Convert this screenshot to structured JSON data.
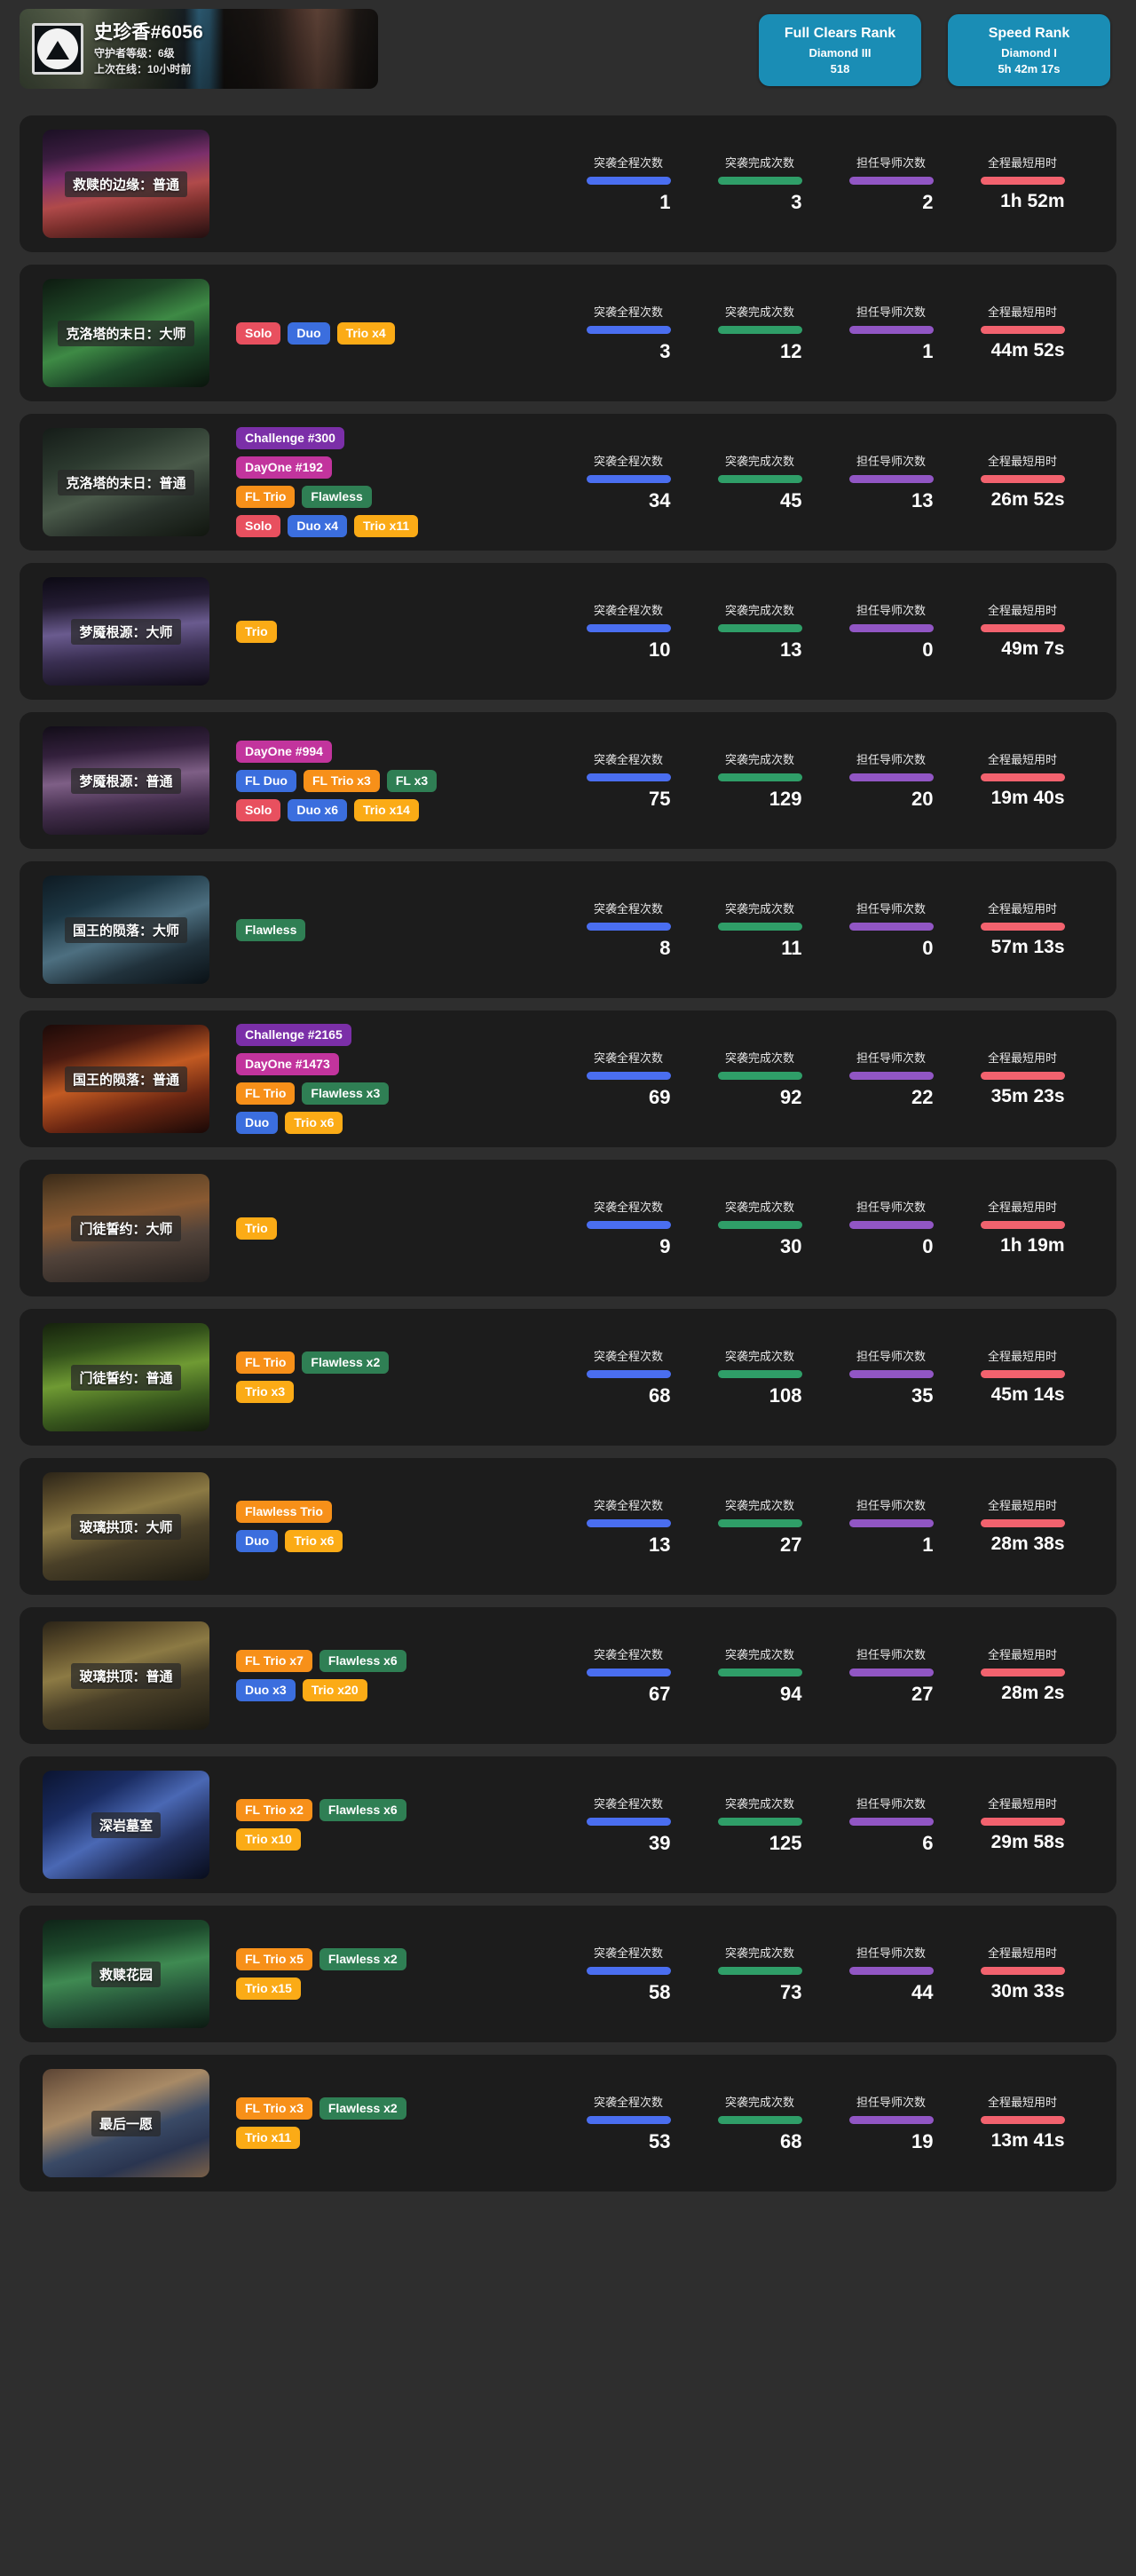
{
  "header": {
    "profile": {
      "name": "史珍香#6056",
      "guardian_rank_line": "守护者等级：6级",
      "last_online_line": "上次在线：10小时前",
      "emblem_icon": "triangle-emblem-icon"
    },
    "badges": [
      {
        "id": "full-clears-rank",
        "title": "Full Clears Rank",
        "tier": "Diamond III",
        "value": "518",
        "color": "#1a8db5"
      },
      {
        "id": "speed-rank",
        "title": "Speed Rank",
        "tier": "Diamond I",
        "value": "5h 42m 17s",
        "color": "#1a8db5"
      }
    ]
  },
  "stat_columns": [
    {
      "key": "full_runs",
      "label": "突袭全程次数",
      "color": "#4a6ef0"
    },
    {
      "key": "completions",
      "label": "突袭完成次数",
      "color": "#2f9e68"
    },
    {
      "key": "sherpa",
      "label": "担任导师次数",
      "color": "#9156c4"
    },
    {
      "key": "fastest",
      "label": "全程最短用时",
      "color": "#f2626e"
    }
  ],
  "tag_colors": {
    "challenge": "#7b2fa8",
    "dayone": "#c2349d",
    "flawless": "#2f7f54",
    "fl_trio": "#f79019",
    "fl_duo": "#3b6ede",
    "solo": "#e8505f",
    "duo": "#3b6ede",
    "trio": "#fbab16"
  },
  "raids": [
    {
      "title": "救赎的边缘：普通",
      "art": "linear-gradient(170deg,#1b1024 0%,#3a1c3f 22%,#7b2f6b 38%,#b04a4a 58%,#7a2f2c 74%,#220f10 100%)",
      "tags": [],
      "stats": {
        "full_runs": "1",
        "completions": "3",
        "sherpa": "2",
        "fastest": "1h 52m"
      }
    },
    {
      "title": "克洛塔的末日：大师",
      "art": "linear-gradient(160deg,#0d1a10 0%,#1f4727 30%,#3e8a45 50%,#1e4a2a 70%,#0a140c 100%)",
      "tags": [
        [
          {
            "text": "Solo",
            "style": "solo"
          },
          {
            "text": "Duo",
            "style": "duo"
          },
          {
            "text": "Trio x4",
            "style": "trio"
          }
        ]
      ],
      "stats": {
        "full_runs": "3",
        "completions": "12",
        "sherpa": "1",
        "fastest": "44m 52s"
      }
    },
    {
      "title": "克洛塔的末日：普通",
      "art": "linear-gradient(160deg,#151c18 0%,#2c3a2f 30%,#4a5a4a 52%,#2a332c 72%,#11160f 100%)",
      "tags": [
        [
          {
            "text": "Challenge #300",
            "style": "challenge"
          }
        ],
        [
          {
            "text": "DayOne #192",
            "style": "dayone"
          }
        ],
        [
          {
            "text": "FL Trio",
            "style": "fl_trio"
          },
          {
            "text": "Flawless",
            "style": "flawless"
          }
        ],
        [
          {
            "text": "Solo",
            "style": "solo"
          },
          {
            "text": "Duo x4",
            "style": "duo"
          },
          {
            "text": "Trio x11",
            "style": "trio"
          }
        ]
      ],
      "stats": {
        "full_runs": "34",
        "completions": "45",
        "sherpa": "13",
        "fastest": "26m 52s"
      }
    },
    {
      "title": "梦魇根源：大师",
      "art": "linear-gradient(175deg,#0c0a14 0%,#241c33 25%,#6a5b8f 48%,#3a2f52 70%,#100c18 100%)",
      "tags": [
        [
          {
            "text": "Trio",
            "style": "trio"
          }
        ]
      ],
      "stats": {
        "full_runs": "10",
        "completions": "13",
        "sherpa": "0",
        "fastest": "49m 7s"
      }
    },
    {
      "title": "梦魇根源：普通",
      "art": "linear-gradient(175deg,#120d18 0%,#33203c 25%,#7e5f86 48%,#452f4e 70%,#150f1a 100%)",
      "tags": [
        [
          {
            "text": "DayOne #994",
            "style": "dayone"
          }
        ],
        [
          {
            "text": "FL Duo",
            "style": "fl_duo"
          },
          {
            "text": "FL Trio x3",
            "style": "fl_trio"
          },
          {
            "text": "FL x3",
            "style": "flawless"
          }
        ],
        [
          {
            "text": "Solo",
            "style": "solo"
          },
          {
            "text": "Duo x6",
            "style": "duo"
          },
          {
            "text": "Trio x14",
            "style": "trio"
          }
        ]
      ],
      "stats": {
        "full_runs": "75",
        "completions": "129",
        "sherpa": "20",
        "fastest": "19m 40s"
      }
    },
    {
      "title": "国王的陨落：大师",
      "art": "linear-gradient(160deg,#0e1a22 0%,#1d3744 28%,#4d6f80 52%,#21323c 74%,#0a1116 100%)",
      "tags": [
        [
          {
            "text": "Flawless",
            "style": "flawless"
          }
        ]
      ],
      "stats": {
        "full_runs": "8",
        "completions": "11",
        "sherpa": "0",
        "fastest": "57m 13s"
      }
    },
    {
      "title": "国王的陨落：普通",
      "art": "linear-gradient(165deg,#1c0a08 0%,#4a1a10 25%,#c25a22 48%,#6a2612 72%,#190806 100%)",
      "tags": [
        [
          {
            "text": "Challenge #2165",
            "style": "challenge"
          }
        ],
        [
          {
            "text": "DayOne #1473",
            "style": "dayone"
          }
        ],
        [
          {
            "text": "FL Trio",
            "style": "fl_trio"
          },
          {
            "text": "Flawless x3",
            "style": "flawless"
          }
        ],
        [
          {
            "text": "Duo",
            "style": "duo"
          },
          {
            "text": "Trio x6",
            "style": "trio"
          }
        ]
      ],
      "stats": {
        "full_runs": "69",
        "completions": "92",
        "sherpa": "22",
        "fastest": "35m 23s"
      }
    },
    {
      "title": "门徒誓约：大师",
      "art": "linear-gradient(170deg,#3a2a18 0%,#6a4a2a 22%,#8a5a32 40%,#52433a 62%,#24201e 100%)",
      "tags": [
        [
          {
            "text": "Trio",
            "style": "trio"
          }
        ]
      ],
      "stats": {
        "full_runs": "9",
        "completions": "30",
        "sherpa": "0",
        "fastest": "1h 19m"
      }
    },
    {
      "title": "门徒誓约：普通",
      "art": "linear-gradient(170deg,#16220d 0%,#32501a 25%,#6f9a33 48%,#3a5a1e 72%,#131c0c 100%)",
      "tags": [
        [
          {
            "text": "FL Trio",
            "style": "fl_trio"
          },
          {
            "text": "Flawless x2",
            "style": "flawless"
          }
        ],
        [
          {
            "text": "Trio x3",
            "style": "trio"
          }
        ]
      ],
      "stats": {
        "full_runs": "68",
        "completions": "108",
        "sherpa": "35",
        "fastest": "45m 14s"
      }
    },
    {
      "title": "玻璃拱顶：大师",
      "art": "linear-gradient(165deg,#2b2418 0%,#60502c 22%,#8c7a44 40%,#4a4028 62%,#1c1a12 100%)",
      "tags": [
        [
          {
            "text": "Flawless Trio",
            "style": "fl_trio"
          }
        ],
        [
          {
            "text": "Duo",
            "style": "duo"
          },
          {
            "text": "Trio x6",
            "style": "trio"
          }
        ]
      ],
      "stats": {
        "full_runs": "13",
        "completions": "27",
        "sherpa": "1",
        "fastest": "28m 38s"
      }
    },
    {
      "title": "玻璃拱顶：普通",
      "art": "linear-gradient(165deg,#2b2418 0%,#60502c 22%,#8c7a44 40%,#4a4028 62%,#1c1a12 100%)",
      "tags": [
        [
          {
            "text": "FL Trio x7",
            "style": "fl_trio"
          },
          {
            "text": "Flawless x6",
            "style": "flawless"
          }
        ],
        [
          {
            "text": "Duo x3",
            "style": "duo"
          },
          {
            "text": "Trio x20",
            "style": "trio"
          }
        ]
      ],
      "stats": {
        "full_runs": "67",
        "completions": "94",
        "sherpa": "27",
        "fastest": "28m 2s"
      }
    },
    {
      "title": "深岩墓室",
      "art": "linear-gradient(150deg,#0b1430 0%,#1a2c62 28%,#4a68b4 50%,#22305e 72%,#080d1c 100%)",
      "tags": [
        [
          {
            "text": "FL Trio x2",
            "style": "fl_trio"
          },
          {
            "text": "Flawless x6",
            "style": "flawless"
          }
        ],
        [
          {
            "text": "Trio x10",
            "style": "trio"
          }
        ]
      ],
      "stats": {
        "full_runs": "39",
        "completions": "125",
        "sherpa": "6",
        "fastest": "29m 58s"
      }
    },
    {
      "title": "救赎花园",
      "art": "linear-gradient(170deg,#0f2418 0%,#1d4a2c 26%,#3f8a52 48%,#27563a 70%,#0c1a12 100%)",
      "tags": [
        [
          {
            "text": "FL Trio x5",
            "style": "fl_trio"
          },
          {
            "text": "Flawless x2",
            "style": "flawless"
          }
        ],
        [
          {
            "text": "Trio x15",
            "style": "trio"
          }
        ]
      ],
      "stats": {
        "full_runs": "58",
        "completions": "73",
        "sherpa": "44",
        "fastest": "30m 33s"
      }
    },
    {
      "title": "最后一愿",
      "art": "linear-gradient(160deg,#5b4434 0%,#8a6d50 20%,#a88a66 36%,#3a4a66 58%,#2a3550 76%,#7a6048 100%)",
      "tags": [
        [
          {
            "text": "FL Trio x3",
            "style": "fl_trio"
          },
          {
            "text": "Flawless x2",
            "style": "flawless"
          }
        ],
        [
          {
            "text": "Trio x11",
            "style": "trio"
          }
        ]
      ],
      "stats": {
        "full_runs": "53",
        "completions": "68",
        "sherpa": "19",
        "fastest": "13m 41s"
      }
    }
  ]
}
